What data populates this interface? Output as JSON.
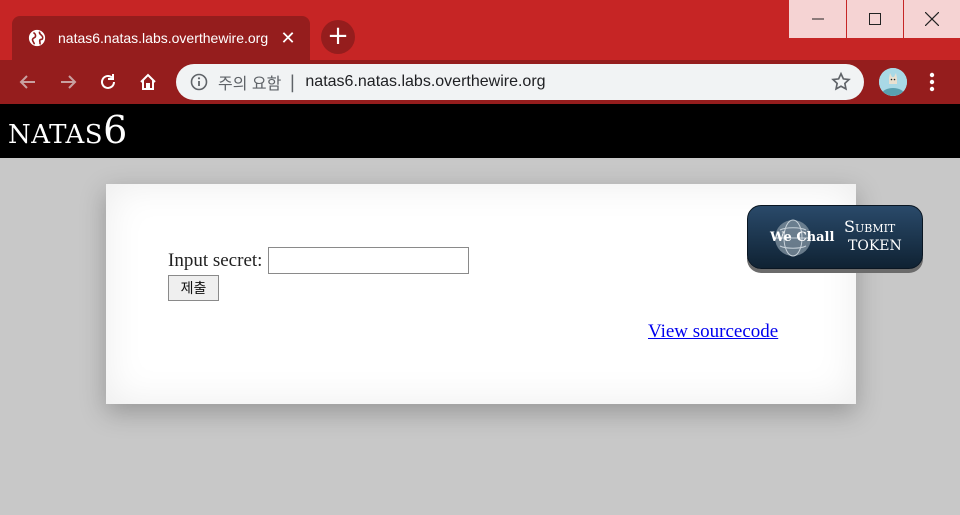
{
  "browser": {
    "tab_title": "natas6.natas.labs.overthewire.org",
    "tab_close": "✕",
    "new_tab": "+",
    "security_label": "주의 요함",
    "separator": "|",
    "url": "natas6.natas.labs.overthewire.org"
  },
  "page": {
    "logo_prefix": "NATAS",
    "logo_number": "6",
    "form": {
      "label": "Input secret:",
      "input_value": "",
      "submit_label": "제출"
    },
    "source_link": "View sourcecode",
    "wechall": {
      "brand": "We Chall",
      "submit": "Submit",
      "token": "TOKEN"
    }
  },
  "colors": {
    "tab_strip": "#c62525",
    "toolbar": "#951d1d",
    "page_background": "#c8c8c8",
    "header": "#000000",
    "link": "#0000ee"
  },
  "icons": [
    "globe-icon",
    "close-icon",
    "plus-icon",
    "minimize-icon",
    "maximize-icon",
    "window-close-icon",
    "back-arrow-icon",
    "forward-arrow-icon",
    "reload-icon",
    "home-icon",
    "info-icon",
    "star-icon",
    "avatar",
    "more-vert-icon"
  ]
}
